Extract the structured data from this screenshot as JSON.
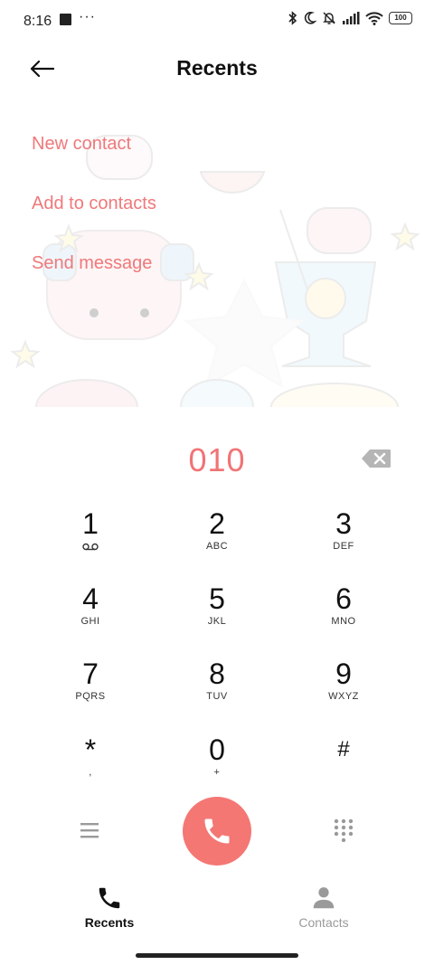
{
  "status_bar": {
    "time": "8:16",
    "dots": "···",
    "battery": "100",
    "icons": [
      "bluetooth-icon",
      "moon-icon",
      "muted-bell-icon",
      "signal-icon",
      "wifi-icon",
      "battery-icon"
    ]
  },
  "header": {
    "title": "Recents",
    "back_icon": "back-arrow-icon"
  },
  "actions": {
    "new_contact": "New contact",
    "add_to_contacts": "Add to contacts",
    "send_message": "Send message"
  },
  "dialer": {
    "number": "010",
    "keys": [
      {
        "digit": "1",
        "letters": ""
      },
      {
        "digit": "2",
        "letters": "ABC"
      },
      {
        "digit": "3",
        "letters": "DEF"
      },
      {
        "digit": "4",
        "letters": "GHI"
      },
      {
        "digit": "5",
        "letters": "JKL"
      },
      {
        "digit": "6",
        "letters": "MNO"
      },
      {
        "digit": "7",
        "letters": "PQRS"
      },
      {
        "digit": "8",
        "letters": "TUV"
      },
      {
        "digit": "9",
        "letters": "WXYZ"
      },
      {
        "digit": "*",
        "letters": ","
      },
      {
        "digit": "0",
        "letters": "+"
      },
      {
        "digit": "#",
        "letters": ""
      }
    ]
  },
  "bottom_nav": {
    "recents": "Recents",
    "contacts": "Contacts"
  },
  "colors": {
    "accent": "#f17476",
    "call_button": "#f47774",
    "text": "#111111",
    "inactive": "#9a9a9a"
  }
}
